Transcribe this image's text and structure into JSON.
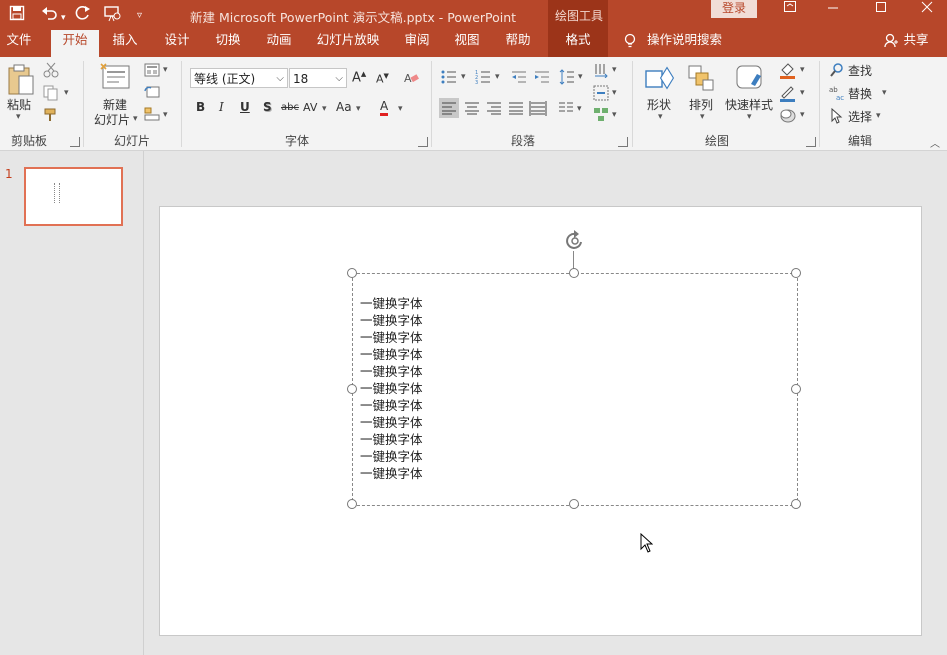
{
  "app": {
    "title": "新建 Microsoft PowerPoint 演示文稿.pptx  -  PowerPoint",
    "context_tab_group": "绘图工具",
    "login_label": "登录",
    "share_label": "共享"
  },
  "tabs": [
    "文件",
    "开始",
    "插入",
    "设计",
    "切换",
    "动画",
    "幻灯片放映",
    "审阅",
    "视图",
    "帮助",
    "格式"
  ],
  "tell_me": "操作说明搜索",
  "ribbon": {
    "clipboard": {
      "paste_label": "粘贴",
      "group_label": "剪贴板"
    },
    "slides": {
      "new_slide_label_1": "新建",
      "new_slide_label_2": "幻灯片",
      "group_label": "幻灯片"
    },
    "font": {
      "font_name": "等线 (正文)",
      "font_size": "18",
      "group_label": "字体"
    },
    "paragraph": {
      "group_label": "段落"
    },
    "drawing": {
      "shape_label": "形状",
      "arrange_label": "排列",
      "quick_style_label": "快速样式",
      "group_label": "绘图"
    },
    "editing": {
      "find_label": "查找",
      "replace_label": "替换",
      "select_label": "选择",
      "group_label": "编辑"
    }
  },
  "thumbnails": {
    "slide_number": "1"
  },
  "slide": {
    "text_lines": [
      "一键换字体",
      "一键换字体",
      "一键换字体",
      "一键换字体",
      "一键换字体",
      "一键换字体",
      "一键换字体",
      "一键换字体",
      "一键换字体",
      "一键换字体",
      "一键换字体"
    ]
  },
  "colors": {
    "accent": "#b7472a",
    "accent_dark": "#9c3419",
    "ribbon_bg": "#f3f3f3",
    "thumb_border": "#e17154"
  }
}
